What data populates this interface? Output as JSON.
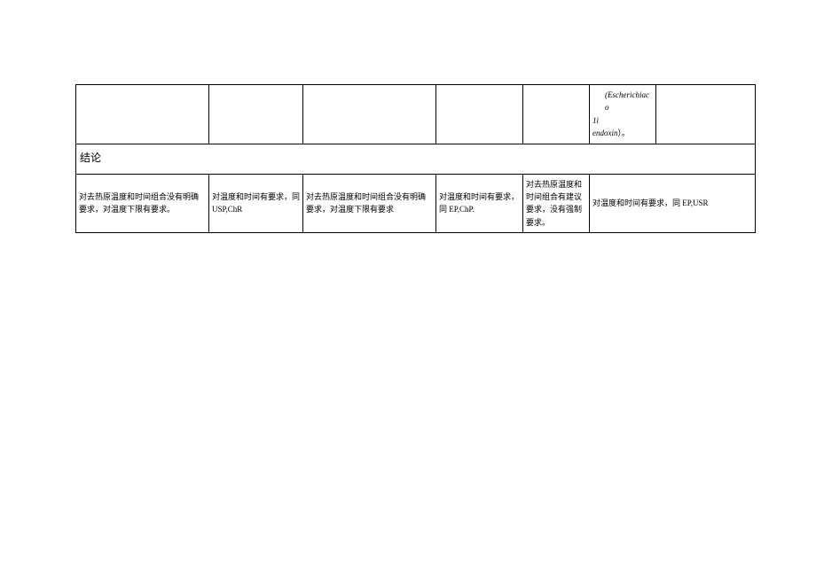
{
  "row1": {
    "c5": {
      "line1": "(Escherichiaco",
      "line2": "1i",
      "line3": "endoxin",
      "line3_suffix": "）。"
    }
  },
  "row2": {
    "label": "结论"
  },
  "row3": {
    "c1": "对去热原温度和时间组合没有明确要求，对温度下限有要求。",
    "c2": "对温度和时间有要求，同 USP,ChR",
    "c3": "对去热原温度和时间组合没有明确要求，对温度下限有要求",
    "c4": "对温度和时间有要求，同 EP,ChP.",
    "c5": "对去热原温度和时间组合有建议要求，没有强制要求。",
    "c6": "对温度和时间有要求，同 EP,USR"
  }
}
